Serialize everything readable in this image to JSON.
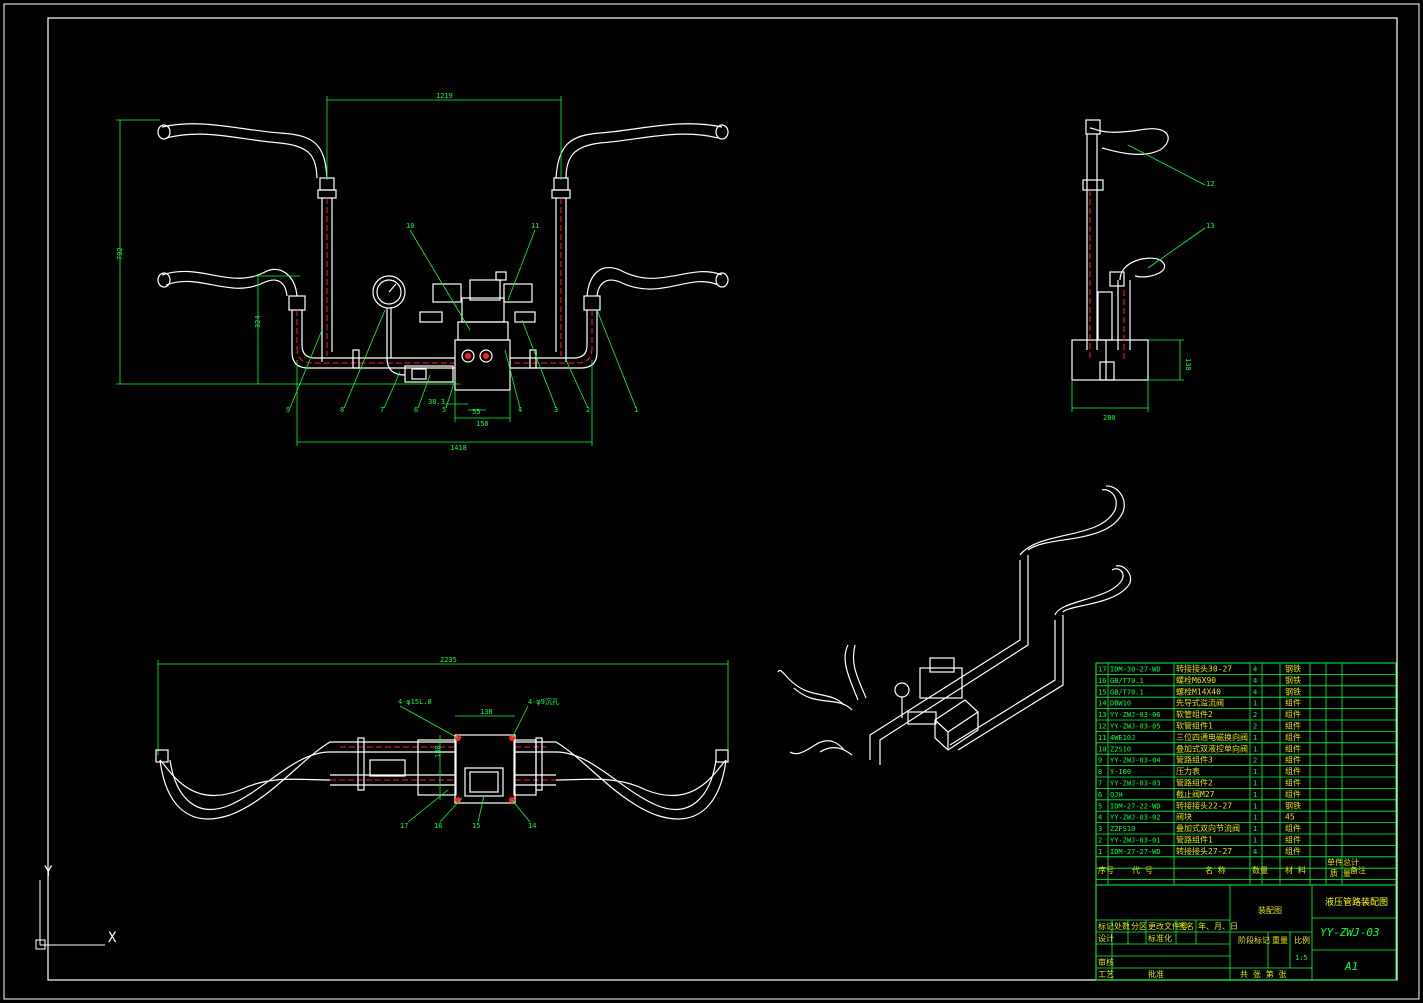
{
  "drawing": {
    "main_view_dims": {
      "top_width": "1219",
      "height_total": "792",
      "height_mid": "324",
      "bottom_width": "1418",
      "block_w": "150",
      "small_a": "38.3",
      "small_b": "55"
    },
    "side_view_dims": {
      "height": "138",
      "width": "280"
    },
    "bottom_view_dims": {
      "total_width": "2235",
      "block_w": "138",
      "block_h": "180",
      "hole_label_left": "4-φ15L.8",
      "hole_label_right": "4-φ9沉孔"
    },
    "callouts_main": [
      "9",
      "8",
      "7",
      "6",
      "5",
      "4",
      "3",
      "2",
      "1",
      "10",
      "11"
    ],
    "callouts_side": [
      "12",
      "13"
    ],
    "callouts_bottom": [
      "17",
      "16",
      "15",
      "14"
    ],
    "axis": {
      "y": "Y",
      "x": "X"
    }
  },
  "bom": {
    "rows": [
      {
        "no": "17",
        "code": "IDM-30-27-WD",
        "name": "转接接头30-27",
        "qty": "4",
        "material": "钢铁",
        "mass": "",
        "remark": ""
      },
      {
        "no": "16",
        "code": "GB/T70.1",
        "name": "螺栓M6X90",
        "qty": "4",
        "material": "钢铁",
        "mass": "",
        "remark": ""
      },
      {
        "no": "15",
        "code": "GB/T70.1",
        "name": "螺栓M14X40",
        "qty": "4",
        "material": "钢铁",
        "mass": "",
        "remark": ""
      },
      {
        "no": "14",
        "code": "DBW10",
        "name": "先导式溢流阀",
        "qty": "1",
        "material": "组件",
        "mass": "",
        "remark": ""
      },
      {
        "no": "13",
        "code": "YY-ZWJ-03-06",
        "name": "软管组件2",
        "qty": "2",
        "material": "组件",
        "mass": "",
        "remark": ""
      },
      {
        "no": "12",
        "code": "YY-ZWJ-03-05",
        "name": "软管组件1",
        "qty": "2",
        "material": "组件",
        "mass": "",
        "remark": ""
      },
      {
        "no": "11",
        "code": "4WE10J",
        "name": "三位四通电磁换向阀",
        "qty": "1",
        "material": "组件",
        "mass": "",
        "remark": ""
      },
      {
        "no": "10",
        "code": "Z2S10",
        "name": "叠加式双液控单向阀",
        "qty": "1",
        "material": "组件",
        "mass": "",
        "remark": ""
      },
      {
        "no": "9",
        "code": "YY-ZWJ-03-04",
        "name": "管路组件3",
        "qty": "2",
        "material": "组件",
        "mass": "",
        "remark": ""
      },
      {
        "no": "8",
        "code": "Y-100",
        "name": "压力表",
        "qty": "1",
        "material": "组件",
        "mass": "",
        "remark": ""
      },
      {
        "no": "7",
        "code": "YY-ZWJ-03-03",
        "name": "管路组件2",
        "qty": "1",
        "material": "组件",
        "mass": "",
        "remark": ""
      },
      {
        "no": "6",
        "code": "QJH",
        "name": "截止阀M27",
        "qty": "1",
        "material": "组件",
        "mass": "",
        "remark": ""
      },
      {
        "no": "5",
        "code": "IDM-27-22-WD",
        "name": "转接接头22-27",
        "qty": "1",
        "material": "钢铁",
        "mass": "",
        "remark": ""
      },
      {
        "no": "4",
        "code": "YY-ZWJ-03-02",
        "name": "阀块",
        "qty": "1",
        "material": "45",
        "mass": "",
        "remark": ""
      },
      {
        "no": "3",
        "code": "Z2FS10",
        "name": "叠加式双向节流阀",
        "qty": "1",
        "material": "组件",
        "mass": "",
        "remark": ""
      },
      {
        "no": "2",
        "code": "YY-ZWJ-03-01",
        "name": "管路组件1",
        "qty": "1",
        "material": "组件",
        "mass": "",
        "remark": ""
      },
      {
        "no": "1",
        "code": "IDM-27-27-WD",
        "name": "转接接头27-27",
        "qty": "4",
        "material": "组件",
        "mass": "",
        "remark": ""
      }
    ],
    "header": {
      "no": "序号",
      "code": "代 号",
      "name": "名 称",
      "qty": "数量",
      "material": "材 料",
      "unit_mass": "单件",
      "total_mass": "总计",
      "mass_label": "质 量",
      "remark": "备注"
    }
  },
  "title_block": {
    "title": "液压管路装配图",
    "drawing_no": "YY-ZWJ-03",
    "sheet_size": "A1",
    "assembly_label": "装配图",
    "scale": "1:5",
    "row_labels": [
      "标记",
      "处数",
      "分区",
      "更改文件号",
      "签名",
      "年、月、日"
    ],
    "designer": "设计",
    "standard": "标准化",
    "stage": "阶段标记",
    "weight": "重量",
    "ratio": "比例",
    "reviewer": "审核",
    "process": "工艺",
    "approve": "批准",
    "sheets": "共  张  第  张"
  }
}
